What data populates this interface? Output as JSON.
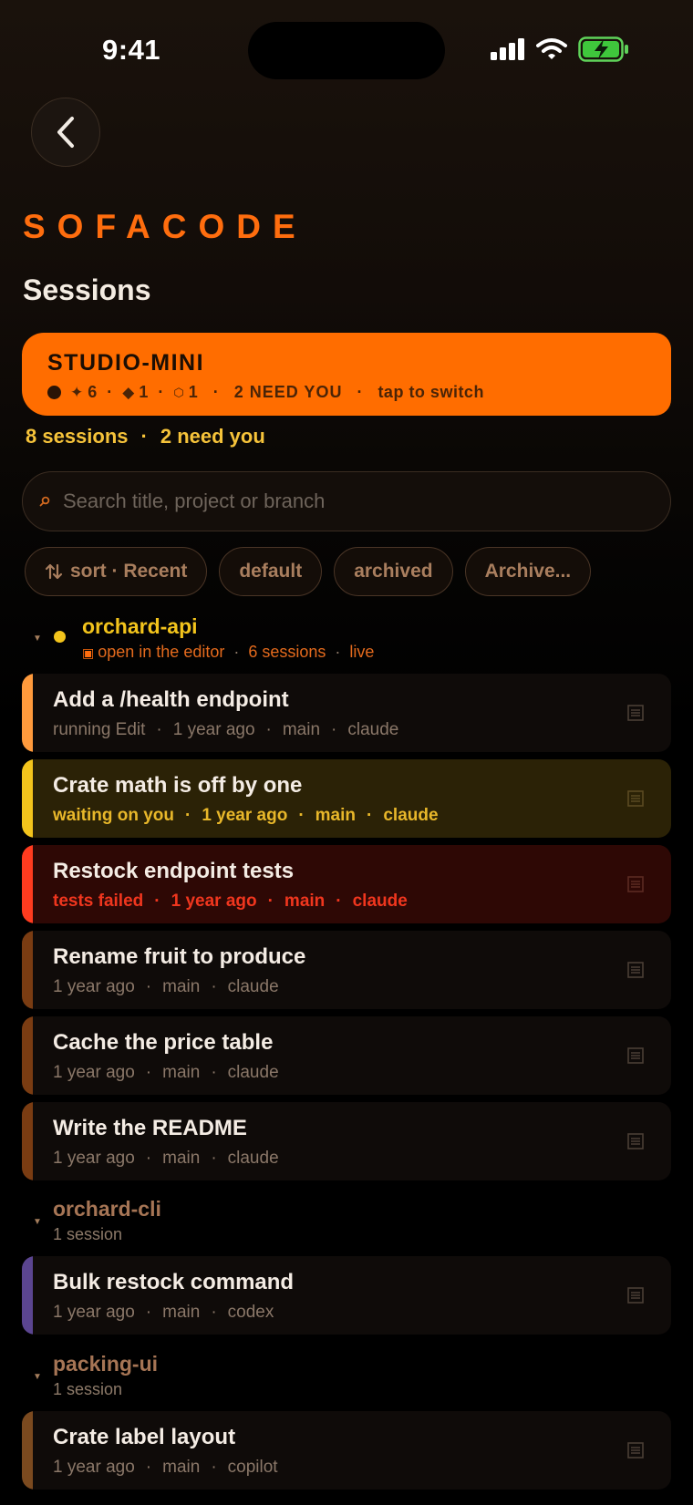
{
  "status_bar": {
    "time": "9:41"
  },
  "brand": "SOFACODE",
  "page_title": "Sessions",
  "machine": {
    "name": "STUDIO-MINI",
    "count_running": "6",
    "count_waiting": "1",
    "count_failed": "1",
    "need_you": "2 NEED YOU",
    "action": "tap to switch"
  },
  "summary": {
    "sessions": "8 sessions",
    "need_you": "2 need you"
  },
  "search": {
    "placeholder": "Search title, project or branch",
    "value": ""
  },
  "filters": {
    "sort_label": "sort · Recent",
    "default_label": "default",
    "archived_label": "archived",
    "archive_label": "Archive..."
  },
  "groups": [
    {
      "name": "orchard-api",
      "editor_label": "open in the editor",
      "count": "6 sessions",
      "state": "live",
      "sessions": [
        {
          "title": "Add a /health endpoint",
          "status": "running Edit",
          "age": "1 year ago",
          "branch": "main",
          "agent": "claude"
        },
        {
          "title": "Crate math is off by one",
          "status": "waiting on you",
          "age": "1 year ago",
          "branch": "main",
          "agent": "claude"
        },
        {
          "title": "Restock endpoint tests",
          "status": "tests failed",
          "age": "1 year ago",
          "branch": "main",
          "agent": "claude"
        },
        {
          "title": "Rename fruit to produce",
          "age": "1 year ago",
          "branch": "main",
          "agent": "claude"
        },
        {
          "title": "Cache the price table",
          "age": "1 year ago",
          "branch": "main",
          "agent": "claude"
        },
        {
          "title": "Write the README",
          "age": "1 year ago",
          "branch": "main",
          "agent": "claude"
        }
      ]
    },
    {
      "name": "orchard-cli",
      "count": "1 session",
      "sessions": [
        {
          "title": "Bulk restock command",
          "age": "1 year ago",
          "branch": "main",
          "agent": "codex"
        }
      ]
    },
    {
      "name": "packing-ui",
      "count": "1 session",
      "sessions": [
        {
          "title": "Crate label layout",
          "age": "1 year ago",
          "branch": "main",
          "agent": "copilot"
        }
      ]
    }
  ],
  "colors": {
    "accent": "#ff6d00",
    "brand": "#ff6d0e",
    "waiting": "#f3c41c",
    "failed": "#ff3b1f",
    "running": "#ff9a3c",
    "idle": "#7a3c12",
    "codex": "#5b4590",
    "copilot": "#7b4a1f"
  },
  "icons": {
    "back": "chevron-left-icon",
    "search": "search-icon",
    "sort": "sort-arrows-icon",
    "row": "terminal-icon",
    "caret": "caret-down-icon"
  }
}
